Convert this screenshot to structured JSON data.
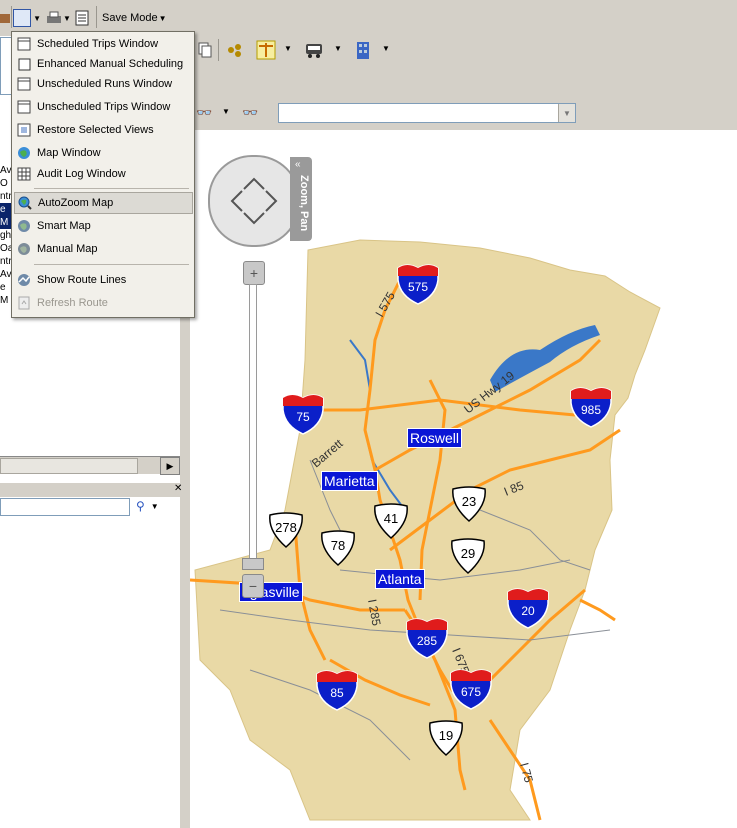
{
  "toolbar": {
    "save_mode_label": "Save Mode"
  },
  "menu": {
    "items": [
      {
        "label": "Scheduled Trips Window",
        "icon": "window-icon"
      },
      {
        "label": "Enhanced Manual Scheduling",
        "icon": "checkbox-icon"
      },
      {
        "label": "Unscheduled Runs Window",
        "icon": "window-icon"
      },
      {
        "label": "Unscheduled Trips Window",
        "icon": "window-icon"
      },
      {
        "label": "Restore Selected Views",
        "icon": "restore-icon"
      },
      {
        "label": "Map Window",
        "icon": "globe-icon"
      },
      {
        "label": "Audit Log Window",
        "icon": "grid-icon"
      },
      {
        "label": "AutoZoom Map",
        "icon": "autozoom-icon"
      },
      {
        "label": "Smart Map",
        "icon": "smart-map-icon"
      },
      {
        "label": "Manual Map",
        "icon": "manual-map-icon"
      },
      {
        "label": "Show Route Lines",
        "icon": "route-lines-icon"
      },
      {
        "label": "Refresh Route",
        "icon": "refresh-icon"
      }
    ]
  },
  "left_panel": {
    "tree_fragments": [
      "Ave",
      "O",
      "ntr",
      "e M",
      "ght",
      "Oa",
      "ntr",
      "Ave",
      "e M"
    ]
  },
  "map": {
    "zoom_pan_label": "Zoom, Pan",
    "cities": [
      "Roswell",
      "Marietta",
      "Atlanta",
      "Douglasville"
    ],
    "city_visible": [
      "Roswell",
      "Marietta",
      "Atlanta",
      "uglasville"
    ],
    "interstates": [
      "575",
      "75",
      "985",
      "20",
      "285",
      "85",
      "675"
    ],
    "us_routes": [
      "23",
      "41",
      "278",
      "78",
      "29",
      "19"
    ],
    "road_labels": [
      "I 575",
      "US Hwy 19",
      "Barrett",
      "I 85",
      "I 285",
      "I 675",
      "I 75"
    ],
    "colors": {
      "land": "#e9d9a6",
      "highway": "#ff9a1e",
      "water": "#3a78c8",
      "city_label": "#0a16d6"
    }
  }
}
